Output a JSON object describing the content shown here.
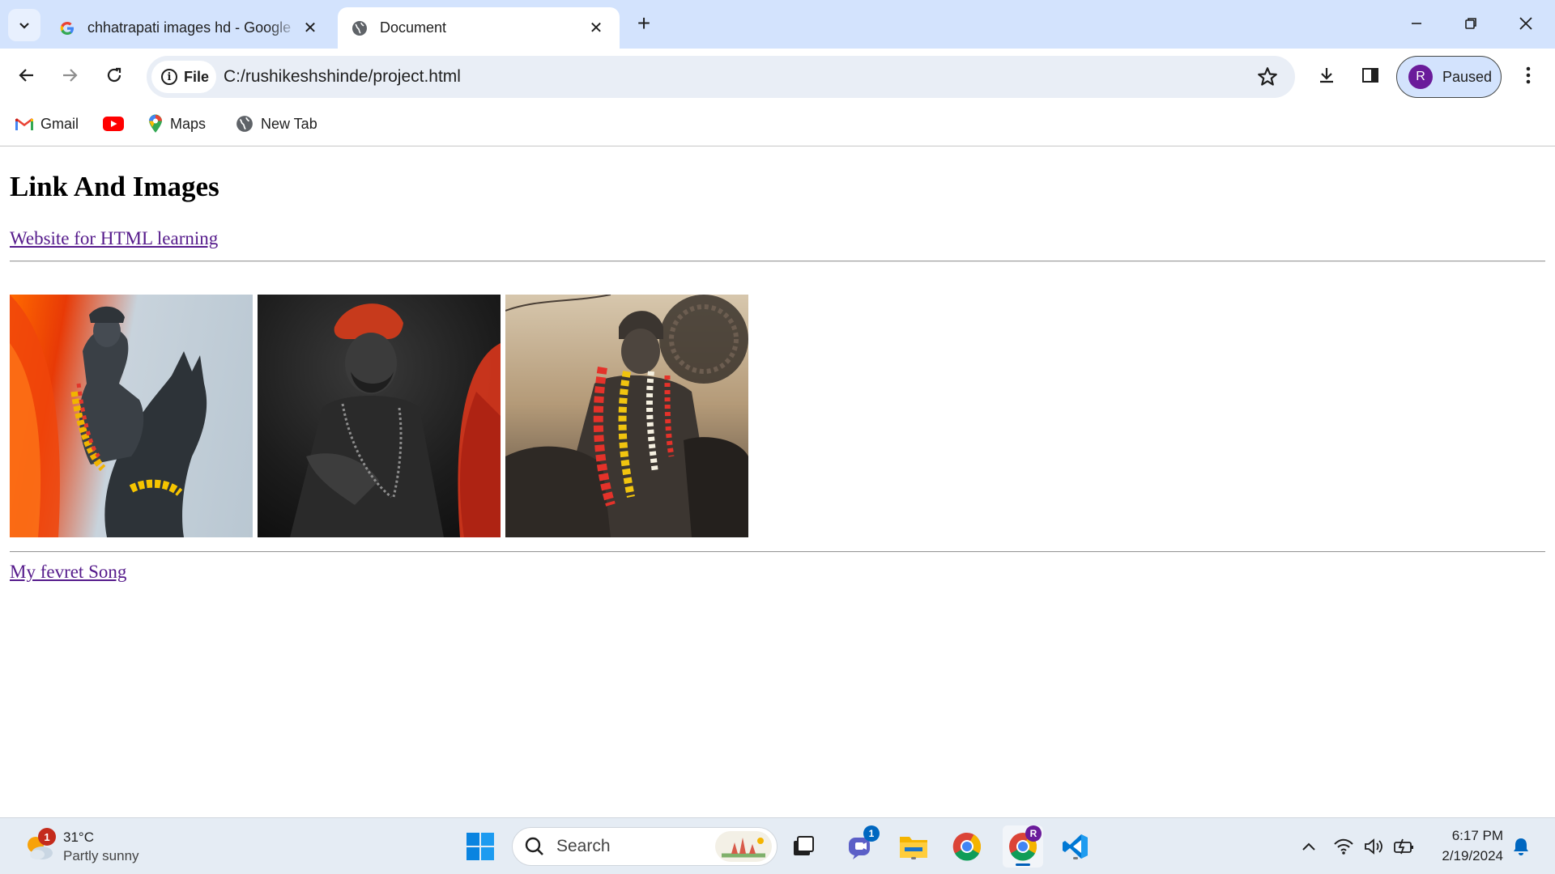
{
  "browser": {
    "tabs": [
      {
        "title": "chhatrapati images hd - Google",
        "active": false,
        "favicon": "google-g-icon"
      },
      {
        "title": "Document",
        "active": true,
        "favicon": "globe-icon"
      }
    ],
    "new_tab_label": "+",
    "address": {
      "scheme_label": "File",
      "url": "C:/rushikeshshinde/project.html"
    },
    "profile": {
      "initial": "R",
      "status": "Paused"
    },
    "bookmarks": [
      {
        "label": "Gmail",
        "icon": "gmail-icon"
      },
      {
        "label": "",
        "icon": "youtube-icon"
      },
      {
        "label": "Maps",
        "icon": "maps-pin-icon"
      },
      {
        "label": "New Tab",
        "icon": "globe-icon"
      }
    ]
  },
  "page": {
    "heading": "Link And Images",
    "link1": "Website for HTML learning",
    "images": [
      {
        "name": "statue-image-1",
        "desc_colors": [
          "#ff6a00",
          "#c8d3dc"
        ]
      },
      {
        "name": "statue-image-2",
        "desc_colors": [
          "#1c1c1c",
          "#d9361c"
        ]
      },
      {
        "name": "statue-image-3",
        "desc_colors": [
          "#d7c7ad",
          "#4a3f36"
        ]
      }
    ],
    "link2": "My fevret Song"
  },
  "taskbar": {
    "weather": {
      "badge": "1",
      "temp": "31°C",
      "condition": "Partly sunny"
    },
    "search_placeholder": "Search",
    "teams_badge": "1",
    "chrome_profile_badge": "R",
    "clock": {
      "time": "6:17 PM",
      "date": "2/19/2024"
    }
  },
  "colors": {
    "tabstrip": "#d3e3fd",
    "omnibox": "#e9eef6",
    "visited_link": "#551a8b",
    "profile_avatar": "#6a1b9a",
    "taskbar": "#e5ecf4"
  }
}
